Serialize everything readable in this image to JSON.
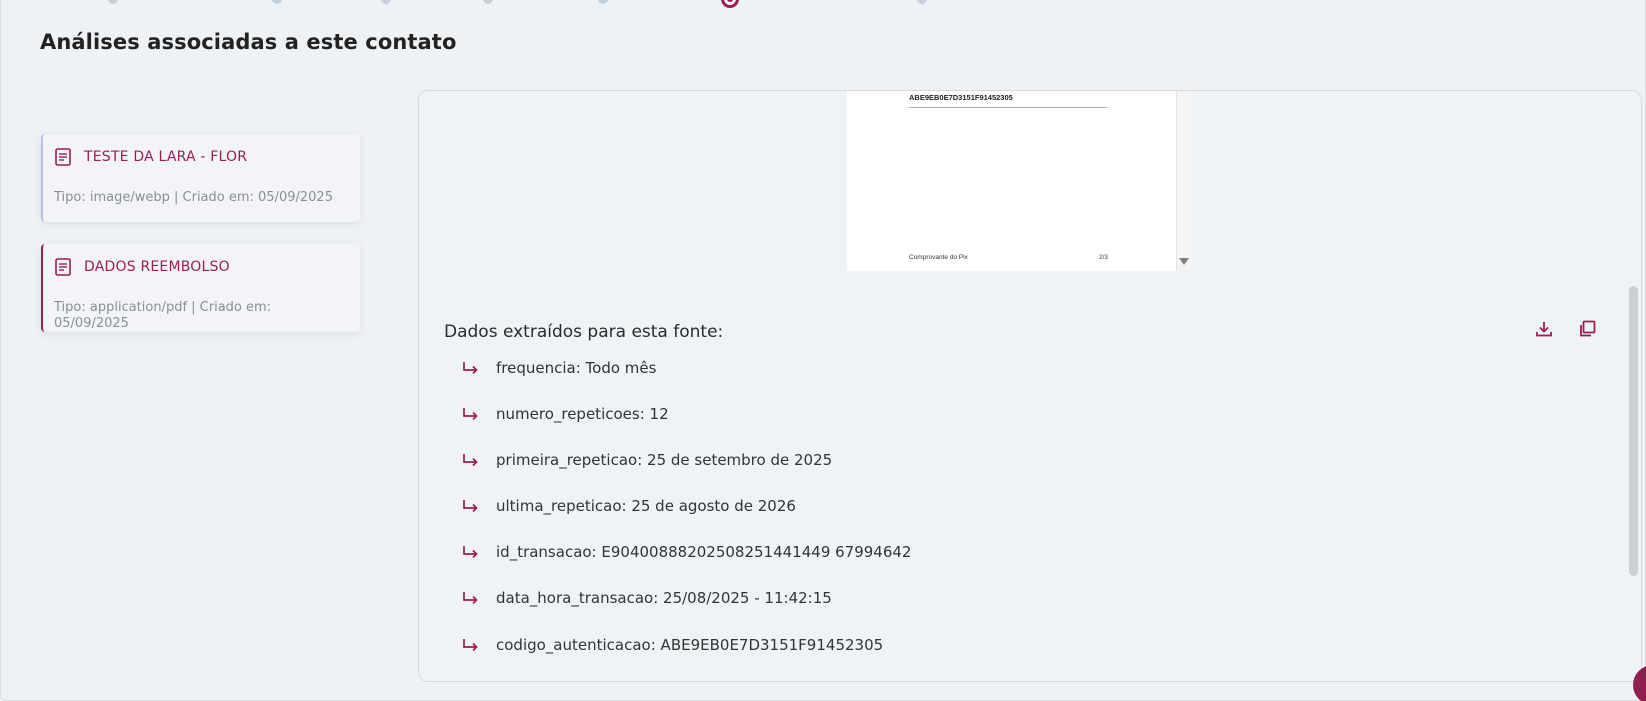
{
  "section": {
    "title": "Análises associadas a este contato"
  },
  "cards": [
    {
      "title": "TESTE DA LARA - FLOR",
      "meta": "Tipo: image/webp | Criado em: 05/09/2025",
      "icon": "document-icon"
    },
    {
      "title": "DADOS REEMBOLSO",
      "meta_line1": "Tipo: application/pdf | Criado em:",
      "meta_line2": "05/09/2025",
      "icon": "document-icon"
    }
  ],
  "preview": {
    "code": "ABE9EB0E7D3151F91452305",
    "footer_left": "Comprovante do Pix",
    "footer_right": "2/3"
  },
  "extracted": {
    "title": "Dados extraídos para esta fonte:",
    "download_icon": "download-icon",
    "copy_icon": "copy-icon",
    "items": [
      "frequencia: Todo mês",
      "numero_repeticoes: 12",
      "primeira_repeticao: 25 de setembro de 2025",
      "ultima_repeticao: 25 de agosto de 2026",
      "id_transacao: E90400888202508251441449 67994642",
      "data_hora_transacao: 25/08/2025 - 11:42:15",
      "codigo_autenticacao: ABE9EB0E7D3151F91452305"
    ]
  },
  "colors": {
    "accent": "#9b1d55",
    "background": "#eef2f5"
  }
}
